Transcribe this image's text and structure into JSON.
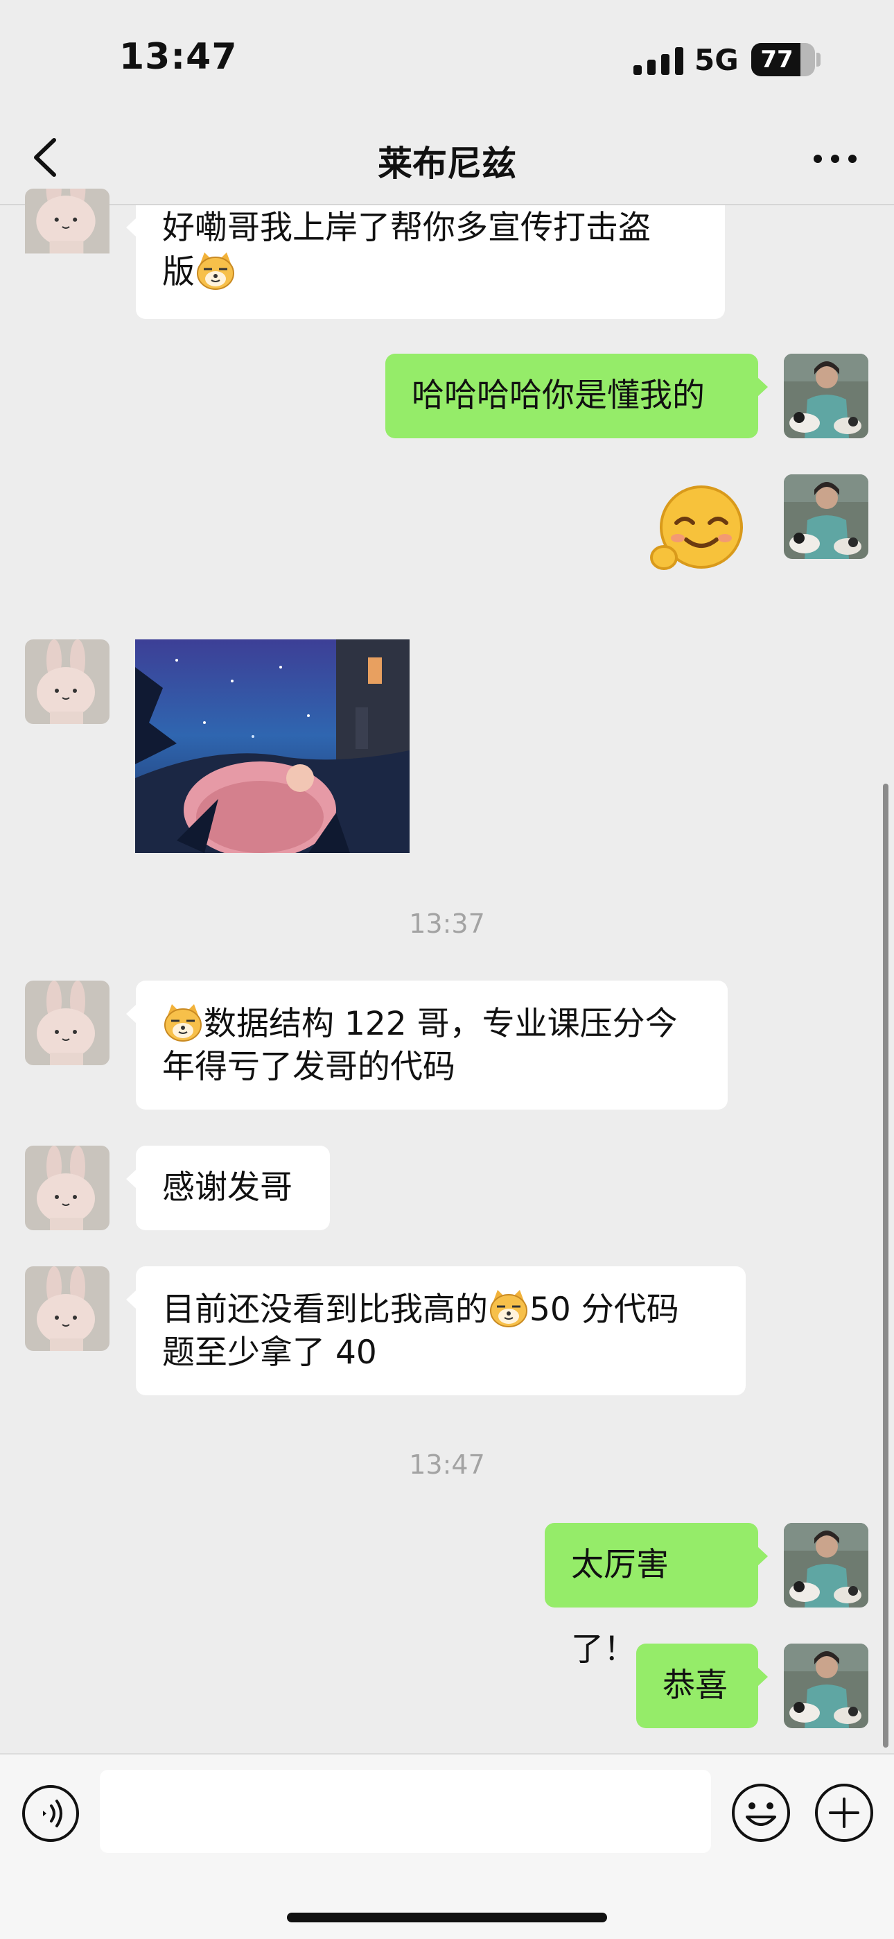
{
  "status_bar": {
    "time": "13:47",
    "network": "5G",
    "battery": "77",
    "battery_level": 0.77
  },
  "header": {
    "title": "莱布尼兹",
    "back_icon": "chevron-left-icon",
    "more_icon": "ellipsis-icon"
  },
  "messages": [
    {
      "side": "incoming",
      "text": "好嘞哥我上岸了帮你多宣传打击盗\n版",
      "trailing_emoji": "cat-face-emoji"
    },
    {
      "side": "outgoing",
      "text": "哈哈哈哈你是懂我的"
    },
    {
      "side": "outgoing",
      "type": "sticker",
      "sticker": "smiling-face-sticker"
    },
    {
      "side": "incoming",
      "type": "image",
      "image": "night-scene-photo"
    },
    {
      "type": "timestamp",
      "text": "13:37"
    },
    {
      "side": "incoming",
      "leading_emoji": "cat-face-emoji",
      "text": "数据结构 122 哥，专业课压分今\n年得亏了发哥的代码"
    },
    {
      "side": "incoming",
      "text": "感谢发哥"
    },
    {
      "side": "incoming",
      "text_before": "目前还没看到比我高的",
      "inline_emoji": "cat-face-emoji",
      "text_after": "50 分代码\n题至少拿了 40"
    },
    {
      "type": "timestamp",
      "text": "13:47"
    },
    {
      "side": "outgoing",
      "text": "太厉害了！"
    },
    {
      "side": "outgoing",
      "text": "恭喜"
    }
  ],
  "avatars": {
    "contact": "bunny-avatar",
    "self": "person-with-cats-avatar"
  },
  "input_bar": {
    "voice_icon": "voice-icon",
    "emoji_icon": "smiley-icon",
    "plus_icon": "plus-icon",
    "input_value": ""
  },
  "colors": {
    "background": "#ededed",
    "outgoing_bubble": "#95ec69",
    "incoming_bubble": "#ffffff",
    "timestamp": "#a3a3a3"
  }
}
